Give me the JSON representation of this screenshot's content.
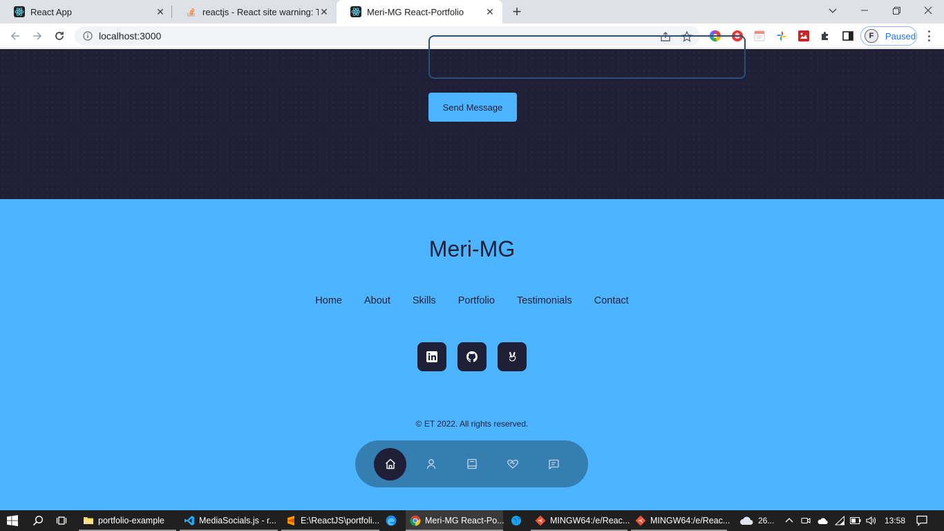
{
  "browser": {
    "tabs": [
      {
        "title": "React App",
        "active": false
      },
      {
        "title": "reactjs - React site warning: The href",
        "active": false
      },
      {
        "title": "Meri-MG React-Portfolio",
        "active": true
      }
    ],
    "new_tab": "+",
    "url": "localhost:3000",
    "profile_initial": "F",
    "profile_status": "Paused"
  },
  "contact": {
    "send_label": "Send Message"
  },
  "footer": {
    "logo": "Meri-MG",
    "links": [
      "Home",
      "About",
      "Skills",
      "Portfolio",
      "Testimonials",
      "Contact"
    ],
    "socials": [
      "linkedin-icon",
      "github-icon",
      "angellist-icon"
    ],
    "copyright": "© ET 2022. All rights reserved."
  },
  "bottom_nav": {
    "items": [
      "home-icon",
      "user-icon",
      "book-icon",
      "handshake-icon",
      "message-icon"
    ],
    "active": "home-icon"
  },
  "colors": {
    "bg": "#1f1f38",
    "primary": "#4db5ff",
    "tab_strip": "#dee1e6"
  },
  "taskbar": {
    "apps": [
      {
        "label": "portfolio-example",
        "icon": "folder-icon"
      },
      {
        "label": "MediaSocials.js - r...",
        "icon": "vscode-icon"
      },
      {
        "label": "E:\\ReactJS\\portfoli...",
        "icon": "sublime-icon"
      },
      {
        "label": "Meri-MG React-Po...",
        "icon": "chrome-icon"
      },
      {
        "label": "MINGW64:/e/Reac...",
        "icon": "git-bash-icon"
      },
      {
        "label": "MINGW64:/e/Reac...",
        "icon": "git-bash-icon"
      }
    ],
    "weather": "26...",
    "time": "13:58"
  }
}
